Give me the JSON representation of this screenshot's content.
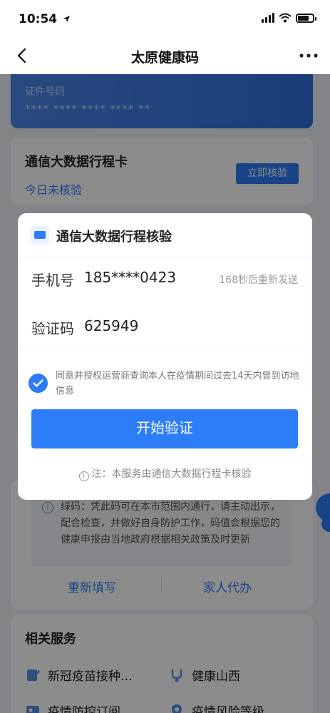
{
  "status_bar": {
    "time": "10:54",
    "location_icon": "location-arrow-icon",
    "battery_level": 0.75
  },
  "nav": {
    "title": "太原健康码",
    "back_icon": "chevron-left-icon",
    "more_icon": "more-dots-icon"
  },
  "id_card": {
    "label": "证件号码",
    "value": "**** **** **** **** **"
  },
  "trip_card": {
    "title": "通信大数据行程卡",
    "status": "今日未核验",
    "button": "立即核验"
  },
  "notice": {
    "text": "绿码：凭此码可在本市范围内通行，请主动出示，配合检查，并做好自身防护工作，码值会根据您的健康申报由当地政府根据相关政策及时更新"
  },
  "actions": {
    "refill": "重新填写",
    "family": "家人代办"
  },
  "services": {
    "title": "相关服务",
    "items": [
      {
        "label": "新冠疫苗接种…",
        "icon": "vaccine-icon"
      },
      {
        "label": "健康山西",
        "icon": "health-icon"
      },
      {
        "label": "疫情防控订阅…",
        "icon": "epidemic-icon"
      },
      {
        "label": "疫情风险等级…",
        "icon": "risk-level-icon"
      }
    ]
  },
  "modal": {
    "title": "通信大数据行程核验",
    "phone_label": "手机号",
    "phone_value": "185****0423",
    "resend": "168秒后重新发送",
    "code_label": "验证码",
    "code_value": "625949",
    "consent": "同意并授权运营商查询本人在疫情期间过去14天内曾到访地信息",
    "consent_checked": true,
    "start_button": "开始验证",
    "note": "注：本服务由通信大数据行程卡核验"
  },
  "colors": {
    "primary": "#2d7cf6",
    "card_blue": "#3a78e4"
  }
}
